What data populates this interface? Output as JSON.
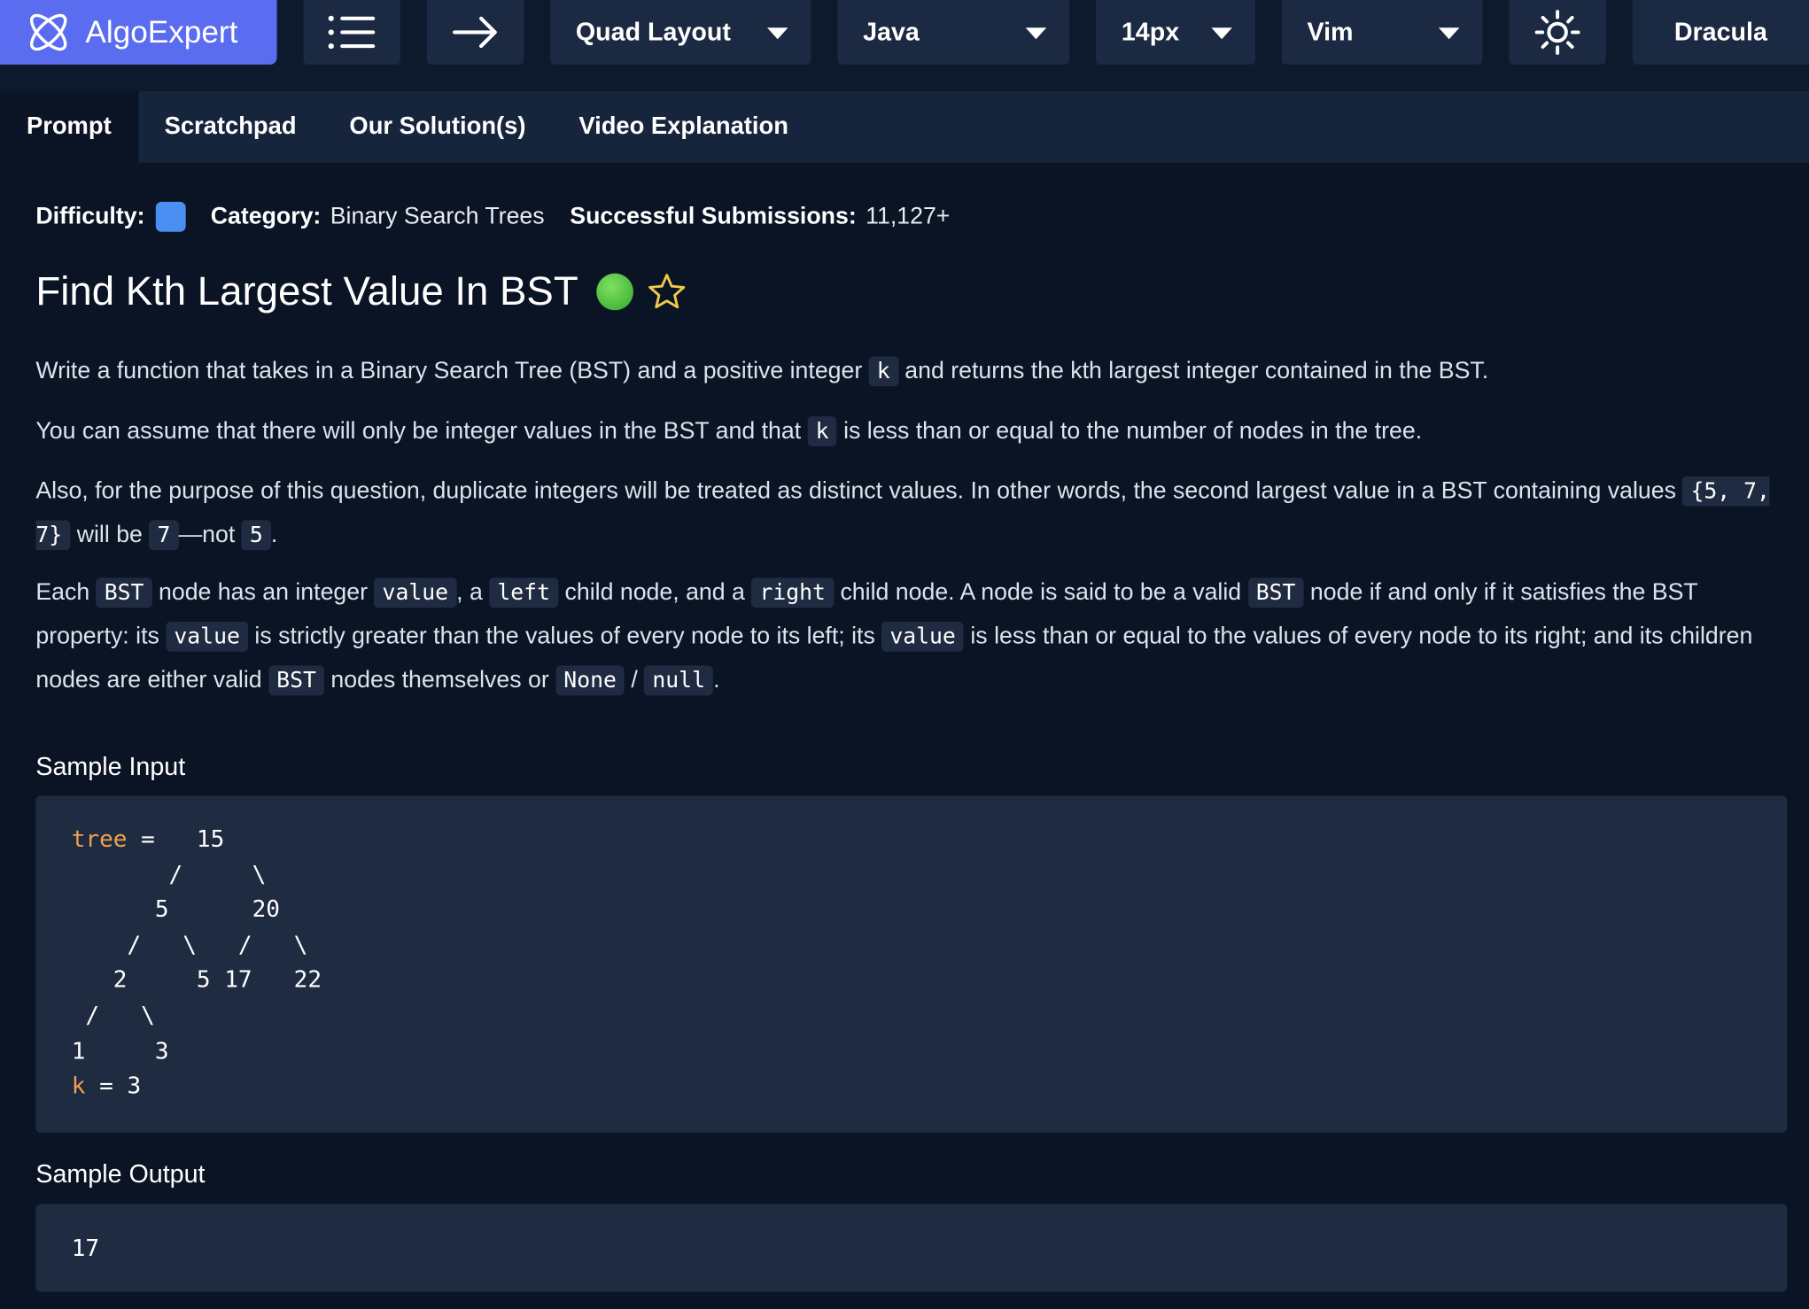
{
  "toolbar": {
    "logo_text": "AlgoExpert",
    "layout_label": "Quad Layout",
    "language_label": "Java",
    "font_size_label": "14px",
    "keymap_label": "Vim",
    "theme_label": "Dracula",
    "icons": [
      "algoexpert-logo-icon",
      "menu-list-icon",
      "arrow-right-icon",
      "sun-icon"
    ]
  },
  "tabs": [
    {
      "label": "Prompt",
      "active": true
    },
    {
      "label": "Scratchpad",
      "active": false
    },
    {
      "label": "Our Solution(s)",
      "active": false
    },
    {
      "label": "Video Explanation",
      "active": false
    }
  ],
  "meta": {
    "difficulty_label": "Difficulty:",
    "difficulty_color": "#4c8ff2",
    "category_label": "Category:",
    "category_value": "Binary Search Trees",
    "submissions_label": "Successful Submissions:",
    "submissions_value": "11,127+"
  },
  "question": {
    "title": "Find Kth Largest Value In BST",
    "status_color": "#3fb432",
    "p1": [
      "Write a function that takes in a Binary Search Tree (BST) and a positive integer ",
      "k",
      " and returns the kth largest integer contained in the BST."
    ],
    "p2": [
      "You can assume that there will only be integer values in the BST and that ",
      "k",
      " is less than or equal to the number of nodes in the tree."
    ],
    "p3": [
      "Also, for the purpose of this question, duplicate integers will be treated as distinct values. In other words, the second largest value in a BST containing values ",
      "{5, 7, 7}",
      " will be ",
      "7",
      "—not ",
      "5",
      "."
    ],
    "p4": [
      "Each ",
      "BST",
      " node has an integer ",
      "value",
      ", a ",
      "left",
      " child node, and a ",
      "right",
      " child node. A node is said to be a valid ",
      "BST",
      " node if and only if it satisfies the BST property: its ",
      "value",
      " is strictly greater than the values of every node to its left; its ",
      "value",
      " is less than or equal to the values of every node to its right; and its children nodes are either valid ",
      "BST",
      " nodes themselves or ",
      "None",
      " / ",
      "null",
      "."
    ]
  },
  "sample_input": {
    "label": "Sample Input",
    "tree_var": "tree",
    "tree_lines": [
      " =   15",
      "       /     \\",
      "      5      20",
      "    /   \\   /   \\",
      "   2     5 17   22",
      " /   \\",
      "1     3"
    ],
    "k_var": "k",
    "k_line": " = 3"
  },
  "sample_output": {
    "label": "Sample Output",
    "value": "17"
  }
}
